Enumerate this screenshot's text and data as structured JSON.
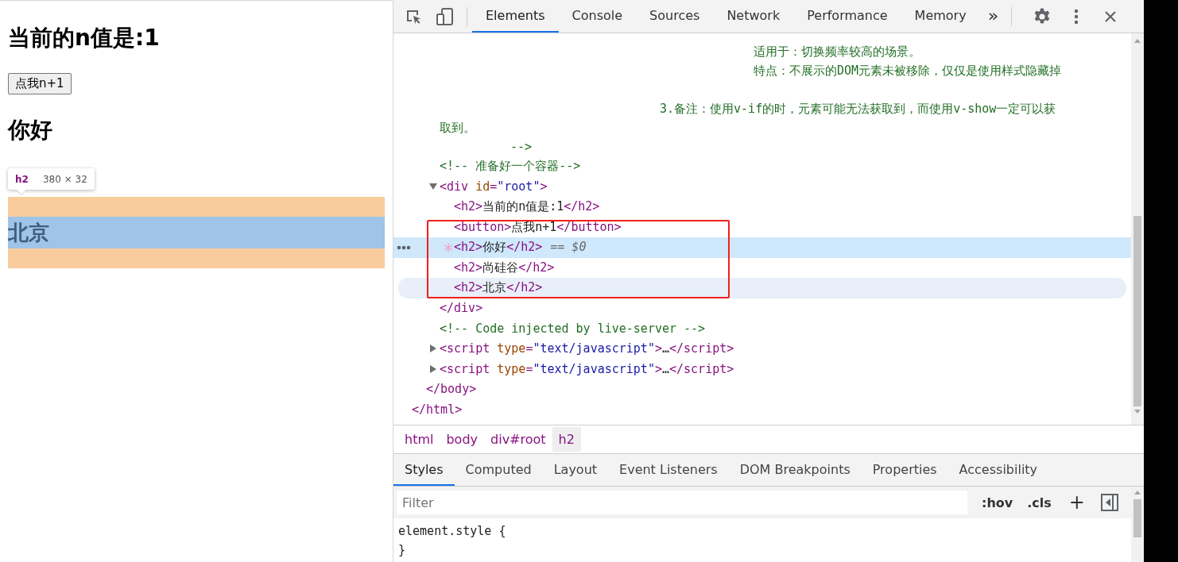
{
  "page": {
    "heading": "当前的n值是:1",
    "button": "点我n+1",
    "greeting": "你好",
    "tooltip": {
      "tag": "h2",
      "size": "380 × 32"
    },
    "highlighted_heading": "北京"
  },
  "devtools": {
    "tabs": [
      {
        "label": "Elements",
        "selected": true
      },
      {
        "label": "Console",
        "selected": false
      },
      {
        "label": "Sources",
        "selected": false
      },
      {
        "label": "Network",
        "selected": false
      },
      {
        "label": "Performance",
        "selected": false
      },
      {
        "label": "Memory",
        "selected": false
      }
    ],
    "overflow": "»",
    "comment_lines": [
      "适用于：切换频率较高的场景。",
      "特点：不展示的DOM元素未被移除，仅仅是使用样式隐藏掉",
      "3.备注：使用v-if的时，元素可能无法获取到，而使用v-show一定可以获",
      "取到。",
      "-->"
    ],
    "dom_tree": [
      {
        "selected": false,
        "hovered": false,
        "parts": [
          {
            "kind": "comment",
            "text": "<!-- 准备好一个容器-->"
          }
        ]
      },
      {
        "selected": false,
        "hovered": false,
        "expanded": true,
        "parts": [
          {
            "kind": "tag",
            "text": "<div "
          },
          {
            "kind": "attr",
            "text": "id"
          },
          {
            "kind": "tag",
            "text": "="
          },
          {
            "kind": "val",
            "text": "\"root\""
          },
          {
            "kind": "tag",
            "text": ">"
          }
        ],
        "children": [
          {
            "selected": false,
            "hovered": false,
            "parts": [
              {
                "kind": "tag",
                "text": "<h2>"
              },
              {
                "kind": "text",
                "text": "当前的n值是:1"
              },
              {
                "kind": "tag",
                "text": "</h2>"
              }
            ]
          },
          {
            "selected": false,
            "hovered": false,
            "parts": [
              {
                "kind": "tag",
                "text": "<button>"
              },
              {
                "kind": "text",
                "text": "点我n+1"
              },
              {
                "kind": "tag",
                "text": "</button>"
              }
            ]
          },
          {
            "selected": true,
            "hovered": false,
            "parts": [
              {
                "kind": "tag",
                "text": "<h2>"
              },
              {
                "kind": "text",
                "text": "你好"
              },
              {
                "kind": "tag",
                "text": "</h2>"
              },
              {
                "kind": "note",
                "text": "== $0"
              }
            ]
          },
          {
            "selected": false,
            "hovered": false,
            "parts": [
              {
                "kind": "tag",
                "text": "<h2>"
              },
              {
                "kind": "text",
                "text": "尚硅谷"
              },
              {
                "kind": "tag",
                "text": "</h2>"
              }
            ]
          },
          {
            "selected": false,
            "hovered": true,
            "parts": [
              {
                "kind": "tag",
                "text": "<h2>"
              },
              {
                "kind": "text",
                "text": "北京"
              },
              {
                "kind": "tag",
                "text": "</h2>"
              }
            ]
          }
        ]
      },
      {
        "selected": false,
        "hovered": false,
        "parts": [
          {
            "kind": "tag",
            "text": "</div>"
          }
        ]
      },
      {
        "selected": false,
        "hovered": false,
        "parts": [
          {
            "kind": "comment",
            "text": "<!-- Code injected by live-server -->"
          }
        ]
      },
      {
        "selected": false,
        "hovered": false,
        "expanded": false,
        "parts": [
          {
            "kind": "tag",
            "text": "<script "
          },
          {
            "kind": "attr",
            "text": "type"
          },
          {
            "kind": "tag",
            "text": "="
          },
          {
            "kind": "val",
            "text": "\"text/javascript\""
          },
          {
            "kind": "tag",
            "text": ">"
          },
          {
            "kind": "text",
            "text": "…"
          },
          {
            "kind": "tag",
            "text": "</script>"
          }
        ]
      },
      {
        "selected": false,
        "hovered": false,
        "expanded": false,
        "parts": [
          {
            "kind": "tag",
            "text": "<script "
          },
          {
            "kind": "attr",
            "text": "type"
          },
          {
            "kind": "tag",
            "text": "="
          },
          {
            "kind": "val",
            "text": "\"text/javascript\""
          },
          {
            "kind": "tag",
            "text": ">"
          },
          {
            "kind": "text",
            "text": "…"
          },
          {
            "kind": "tag",
            "text": "</script>"
          }
        ]
      }
    ],
    "trailing_lines": [
      [
        {
          "kind": "tag",
          "text": "</body>"
        }
      ],
      [
        {
          "kind": "tag",
          "text": "</html>"
        }
      ]
    ],
    "breadcrumbs": [
      {
        "label": "html",
        "selected": false
      },
      {
        "label": "body",
        "selected": false
      },
      {
        "label": "div#root",
        "selected": false
      },
      {
        "label": "h2",
        "selected": true
      }
    ],
    "styles_tabs": [
      {
        "label": "Styles",
        "selected": true
      },
      {
        "label": "Computed",
        "selected": false
      },
      {
        "label": "Layout",
        "selected": false
      },
      {
        "label": "Event Listeners",
        "selected": false
      },
      {
        "label": "DOM Breakpoints",
        "selected": false
      },
      {
        "label": "Properties",
        "selected": false
      },
      {
        "label": "Accessibility",
        "selected": false
      }
    ],
    "filter": {
      "placeholder": "Filter"
    },
    "filter_buttons": [
      ":hov",
      ".cls",
      "+"
    ],
    "style_rule": [
      "element.style {",
      "}"
    ]
  }
}
